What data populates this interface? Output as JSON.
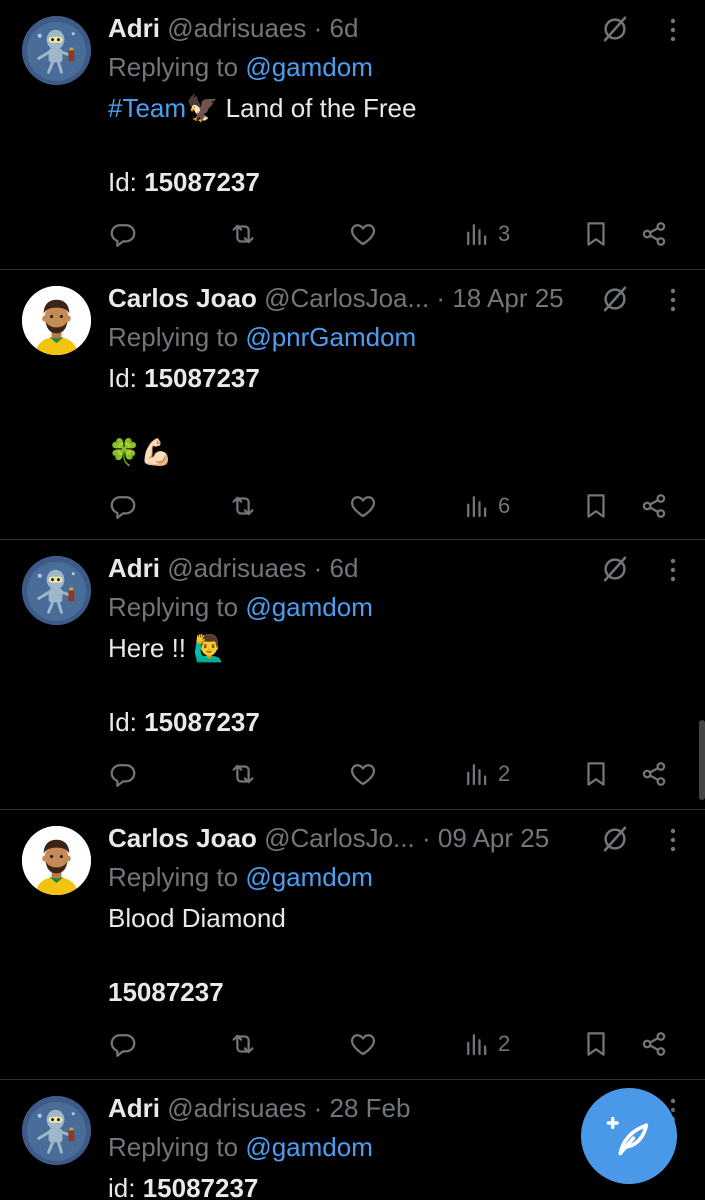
{
  "tweets": [
    {
      "name": "Adri",
      "handle": "@adrisuaes",
      "dot": "·",
      "time": "6d",
      "reply_prefix": "Replying to ",
      "reply_to": "@gamdom",
      "hashtag": "#Team",
      "emoji": "🦅",
      "text_after": " Land of the Free",
      "id_label": "Id: ",
      "id_value": "15087237",
      "views": "3"
    },
    {
      "name": "Carlos Joao",
      "handle": "@CarlosJoa...",
      "dot": "·",
      "time": "18 Apr 25",
      "reply_prefix": "Replying to ",
      "reply_to": "@pnrGamdom",
      "id_label": "Id: ",
      "id_value": "15087237",
      "emojis": "🍀💪🏻",
      "views": "6"
    },
    {
      "name": "Adri",
      "handle": "@adrisuaes",
      "dot": "·",
      "time": "6d",
      "reply_prefix": "Replying to ",
      "reply_to": "@gamdom",
      "text": "Here !! ",
      "emoji": "🙋‍♂️",
      "id_label": "Id: ",
      "id_value": "15087237",
      "views": "2"
    },
    {
      "name": "Carlos Joao",
      "handle": "@CarlosJo...",
      "dot": "·",
      "time": "09 Apr 25",
      "reply_prefix": "Replying to ",
      "reply_to": "@gamdom",
      "text": "Blood Diamond",
      "id_value": "15087237",
      "views": "2"
    },
    {
      "name": "Adri",
      "handle": "@adrisuaes",
      "dot": "·",
      "time": "28 Feb",
      "reply_prefix": "Replying to ",
      "reply_to": "@gamdom",
      "id_label": "id: ",
      "id_value": "15087237"
    }
  ],
  "colors": {
    "accent": "#4c9ff0",
    "muted": "#71767b",
    "text": "#e7e9ea",
    "fab": "#4a99e9"
  },
  "icons": [
    "reply-icon",
    "retweet-icon",
    "like-icon",
    "views-icon",
    "bookmark-icon",
    "share-icon",
    "grok-icon",
    "more-icon",
    "compose-icon"
  ]
}
